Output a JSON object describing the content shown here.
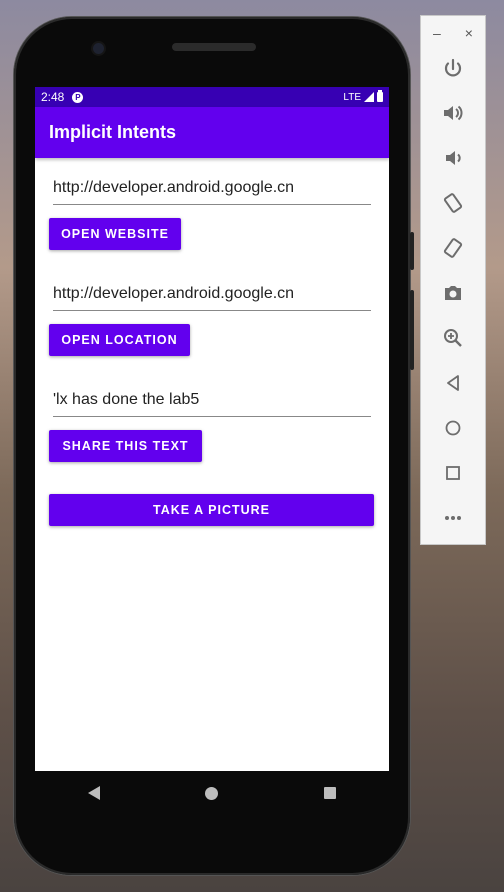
{
  "status_bar": {
    "time": "2:48",
    "network": "LTE"
  },
  "app_bar": {
    "title": "Implicit Intents"
  },
  "website": {
    "url_value": "http://developer.android.google.cn",
    "button_label": "OPEN WEBSITE"
  },
  "location": {
    "value": "http://developer.android.google.cn",
    "button_label": "OPEN LOCATION"
  },
  "share": {
    "value": "'lx has done the lab5",
    "button_label": "SHARE THIS TEXT"
  },
  "picture": {
    "button_label": "TAKE A PICTURE"
  },
  "emulator_toolbar": {
    "minimize": "–",
    "close": "×",
    "items": [
      "power-icon",
      "volume-up-icon",
      "volume-down-icon",
      "rotate-left-icon",
      "rotate-right-icon",
      "camera-icon",
      "zoom-icon",
      "back-icon",
      "home-icon",
      "overview-icon",
      "more-icon"
    ]
  },
  "colors": {
    "primary": "#6200ee",
    "primary_dark": "#3700b3"
  }
}
